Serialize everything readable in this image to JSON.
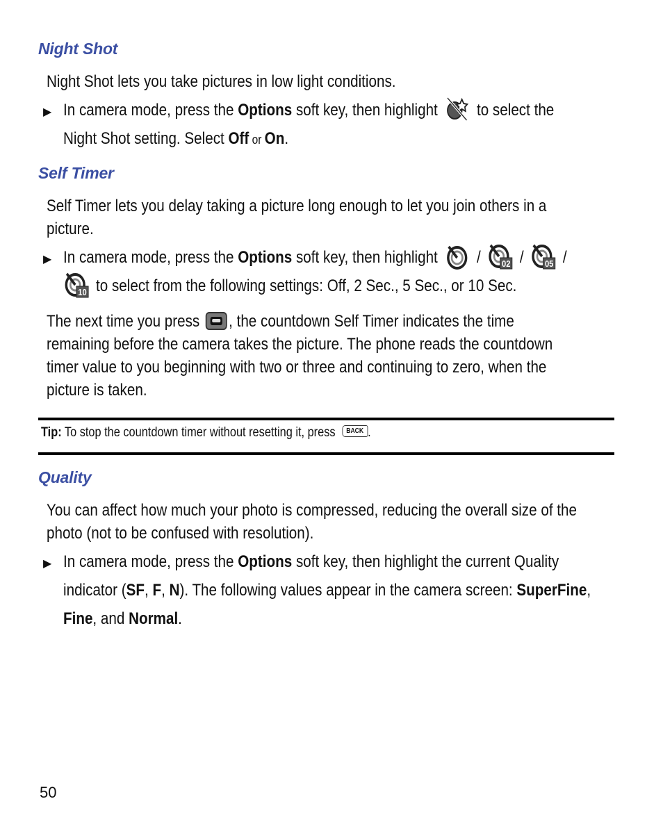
{
  "sections": {
    "night_shot": {
      "heading": "Night Shot",
      "intro": "Night Shot lets you take pictures in low light conditions.",
      "step": {
        "t1": "In camera mode, press the ",
        "options": "Options",
        "t2": " soft key, then highlight ",
        "icon": "night-shot-icon",
        "t3": " to select the",
        "t4": "Night Shot setting. Select ",
        "off": "Off",
        "or": " or ",
        "on": "On",
        "end": "."
      }
    },
    "self_timer": {
      "heading": "Self Timer",
      "intro_line1": "Self Timer lets you delay taking a picture long enough to let you join others in a",
      "intro_line2": "picture.",
      "step": {
        "t1": "In camera mode, press the ",
        "options": "Options",
        "t2": " soft key, then highlight ",
        "sep": " / ",
        "icons": [
          "timer-off-icon",
          "timer-2sec-icon",
          "timer-5sec-icon",
          "timer-10sec-icon"
        ],
        "icon_labels": [
          "",
          "02",
          "05",
          "10"
        ],
        "t3": " to select from the following settings: Off, 2 Sec., 5 Sec., or 10 Sec."
      },
      "para_line1a": "The next time you press ",
      "para_line1b": ", the countdown Self Timer indicates the time",
      "para_line2": "remaining before the camera takes the picture. The phone reads the countdown",
      "para_line3": "timer value to you beginning with two or three and continuing to zero, when the",
      "para_line4": "picture is taken."
    },
    "tip": {
      "label": "Tip:",
      "text": " To stop the countdown timer without resetting it, press ",
      "key": "BACK",
      "end": "."
    },
    "quality": {
      "heading": "Quality",
      "intro_line1": "You can affect how much your photo is compressed, reducing the overall size of the",
      "intro_line2": "photo (not to be confused with resolution).",
      "step": {
        "t1": "In camera mode, press the ",
        "options": "Options",
        "t2": " soft key, then highlight the current Quality",
        "t3": "indicator (",
        "sf": "SF",
        "c1": ", ",
        "f": "F",
        "c2": ", ",
        "n": "N",
        "t4": "). The following values appear in the camera screen: ",
        "superfine": "SuperFine",
        "c3": ",",
        "fine": "Fine",
        "t5": ", and ",
        "normal": "Normal",
        "end": "."
      }
    }
  },
  "page_number": "50",
  "colors": {
    "heading": "#3b4fa3",
    "text": "#111111",
    "rule": "#000000"
  }
}
